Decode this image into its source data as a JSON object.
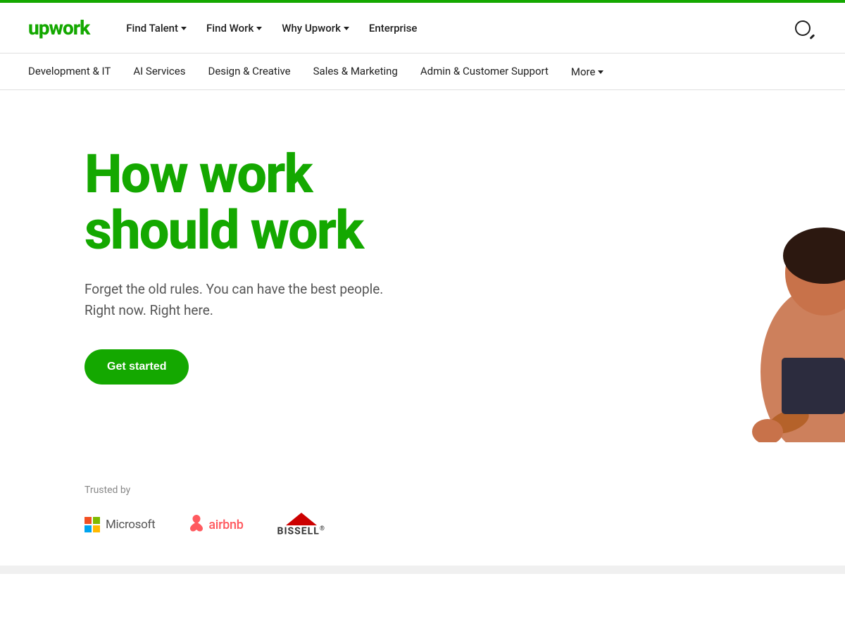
{
  "topBar": {},
  "mainNav": {
    "logo": "upwork",
    "links": [
      {
        "label": "Find Talent",
        "hasDropdown": true
      },
      {
        "label": "Find Work",
        "hasDropdown": true
      },
      {
        "label": "Why Upwork",
        "hasDropdown": true
      },
      {
        "label": "Enterprise",
        "hasDropdown": false
      }
    ]
  },
  "categoryNav": {
    "items": [
      {
        "label": "Development & IT"
      },
      {
        "label": "AI Services"
      },
      {
        "label": "Design & Creative"
      },
      {
        "label": "Sales & Marketing"
      },
      {
        "label": "Admin & Customer Support"
      },
      {
        "label": "More",
        "hasDropdown": true
      }
    ]
  },
  "hero": {
    "title": "How work\nshould work",
    "subtitle": "Forget the old rules. You can have the best people.\nRight now. Right here.",
    "cta": "Get started"
  },
  "trusted": {
    "label": "Trusted by",
    "logos": [
      {
        "name": "Microsoft"
      },
      {
        "name": "airbnb"
      },
      {
        "name": "Bissell"
      }
    ]
  }
}
